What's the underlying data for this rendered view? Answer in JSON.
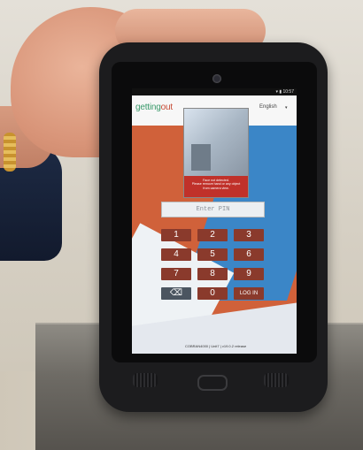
{
  "app": {
    "logo_part1": "getting",
    "logo_part2": "out",
    "language": "English",
    "language_caret": "▾",
    "status_time": "▾ ▮ 10:57"
  },
  "camera_preview": {
    "warning_line1": "Face not detected.",
    "warning_line2": "Please remove hand or any object",
    "warning_line3": "from camera view."
  },
  "pin_input": {
    "placeholder": "Enter PIN",
    "value": ""
  },
  "keypad": {
    "keys": [
      "1",
      "2",
      "3",
      "4",
      "5",
      "6",
      "7",
      "8",
      "9",
      "⌫",
      "0",
      "LOG IN"
    ]
  },
  "footer": {
    "text": "COBRAN4000 | Unit7 | v19.0.2 release"
  },
  "colors": {
    "key": "#8a3a2c",
    "key_dark": "#4b5560",
    "brand_green": "#3a9a6b",
    "brand_red": "#c64a34",
    "bg_orange": "#d0613a",
    "bg_blue": "#3b86c7"
  }
}
